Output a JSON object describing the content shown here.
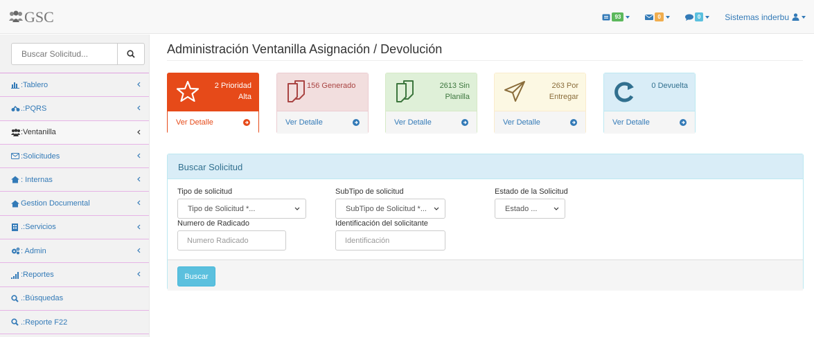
{
  "brand": {
    "name": "GSC",
    "logo_icon": "users-group-icon"
  },
  "topnav": {
    "tasks": {
      "icon": "tasks-icon",
      "count": "93",
      "color": "#5cb85c"
    },
    "mail": {
      "icon": "envelope-icon",
      "count": "0",
      "color": "#f0ad4e"
    },
    "chat": {
      "icon": "comment-icon",
      "count": "0",
      "color": "#5bc0de"
    },
    "user": {
      "name": "Sistemas inderbu",
      "icon": "user-icon"
    }
  },
  "sidebar": {
    "search_placeholder": "Buscar Solicitud...",
    "items": [
      {
        "label": ":Tablero",
        "icon": "bar-chart-icon"
      },
      {
        "label": ".:PQRS",
        "icon": "motorcycle-icon"
      },
      {
        "label": ":Ventanilla",
        "icon": "users-icon"
      },
      {
        "label": ":Solicitudes",
        "icon": "envelope-icon"
      },
      {
        "label": ": Internas",
        "icon": "home-icon"
      },
      {
        "label": "Gestion Documental",
        "icon": "home-icon"
      },
      {
        "label": ".:Servicios",
        "icon": "building-icon"
      },
      {
        "label": ": Admin",
        "icon": "cogs-icon"
      },
      {
        "label": ":Reportes",
        "icon": "signal-icon"
      },
      {
        "label": ".:Búsquedas",
        "icon": "search-icon"
      },
      {
        "label": ".:Reporte F22",
        "icon": "search-icon"
      }
    ]
  },
  "main": {
    "title": "Administración Ventanilla Asignación / Devolución",
    "cards": [
      {
        "line1": "2 Prioridad",
        "line2": "Alta",
        "footer": "Ver Detalle",
        "icon": "star-icon",
        "color": "#e64a19"
      },
      {
        "line1": "156 Generado",
        "line2": "",
        "footer": "Ver Detalle",
        "icon": "files-icon",
        "color": "#a94442"
      },
      {
        "line1": "2613 Sin",
        "line2": "Planilla",
        "footer": "Ver Detalle",
        "icon": "files-icon",
        "color": "#3c763d"
      },
      {
        "line1": "263 Por",
        "line2": "Entregar",
        "footer": "Ver Detalle",
        "icon": "paper-plane-icon",
        "color": "#8a6d3b"
      },
      {
        "line1": "0 Devuelta",
        "line2": "",
        "footer": "Ver Detalle",
        "icon": "refresh-icon",
        "color": "#31708f"
      }
    ],
    "search_panel": {
      "heading": "Buscar Solicitud",
      "tipo_label": "Tipo de solicitud",
      "tipo_value": "Tipo de Solicitud *...",
      "subtipo_label": "SubTipo de solicitud",
      "subtipo_value": "SubTipo de Solicitud *...",
      "estado_label": "Estado de la Solicitud",
      "estado_value": "Estado ...",
      "radicado_label": "Numero de Radicado",
      "radicado_placeholder": "Numero Radicado",
      "ident_label": "Identificación del solicitante",
      "ident_placeholder": "Identificación",
      "button": "Buscar"
    }
  }
}
